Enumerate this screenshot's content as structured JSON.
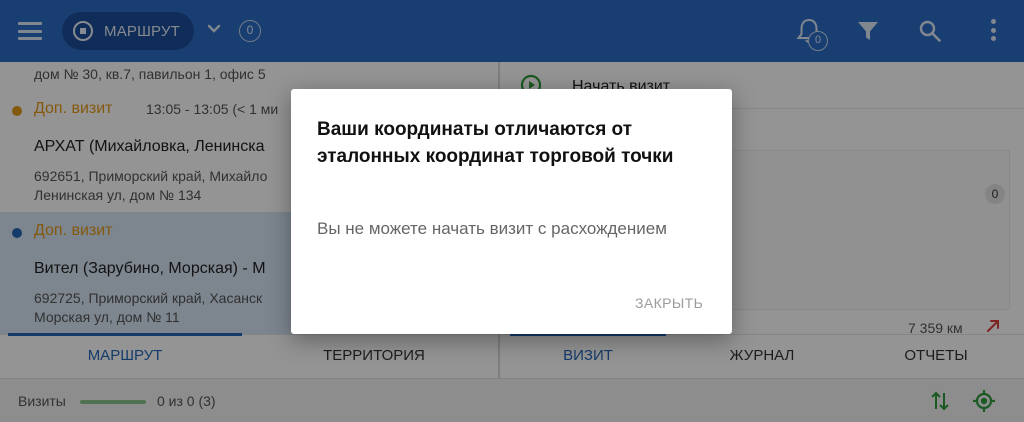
{
  "appbar": {
    "route_label": "МАРШРУТ",
    "route_count": "0",
    "notifications_count": "0",
    "icons": [
      "menu-icon",
      "stop-icon",
      "chevron-down-icon",
      "bell-icon",
      "filter-icon",
      "search-icon",
      "more-vert-icon"
    ]
  },
  "left_list": {
    "top_address": "дом № 30, кв.7, павильон 1, офис 5",
    "items": [
      {
        "type": "Доп. визит",
        "time": "13:05 - 13:05 (< 1 ми",
        "name": "АРХАТ (Михайловка, Ленинска",
        "address_line1": "692651, Приморский край, Михайло",
        "address_line2": "Ленинская ул, дом № 134",
        "dot_color": "#e39a17"
      },
      {
        "type": "Доп. визит",
        "name": "Вител (Зарубино, Морская) - М",
        "address_line1": "692725, Приморский край, Хасанск",
        "address_line2": "Морская ул, дом № 11",
        "dot_color": "#2566b8",
        "selected": true
      }
    ]
  },
  "right_pane": {
    "start_visit": "Начать визит",
    "zero_badge": "0",
    "distance": "7 359 км"
  },
  "tabs_left": [
    "МАРШРУТ",
    "ТЕРРИТОРИЯ"
  ],
  "tabs_right": [
    "ВИЗИТ",
    "ЖУРНАЛ",
    "ОТЧЕТЫ"
  ],
  "status_bar": {
    "visits_label": "Визиты",
    "visits_count": "0 из 0 (3)"
  },
  "dialog": {
    "title": "Ваши координаты отличаются от эталонных координат торговой точки",
    "message": "Вы не можете начать визит с расхождением",
    "close_label": "ЗАКРЫТЬ"
  },
  "colors": {
    "appbar": "#2b6cc4",
    "accent": "#2566b8",
    "orange": "#e39a17",
    "green": "#2e9a3a",
    "red": "#d9413a"
  }
}
